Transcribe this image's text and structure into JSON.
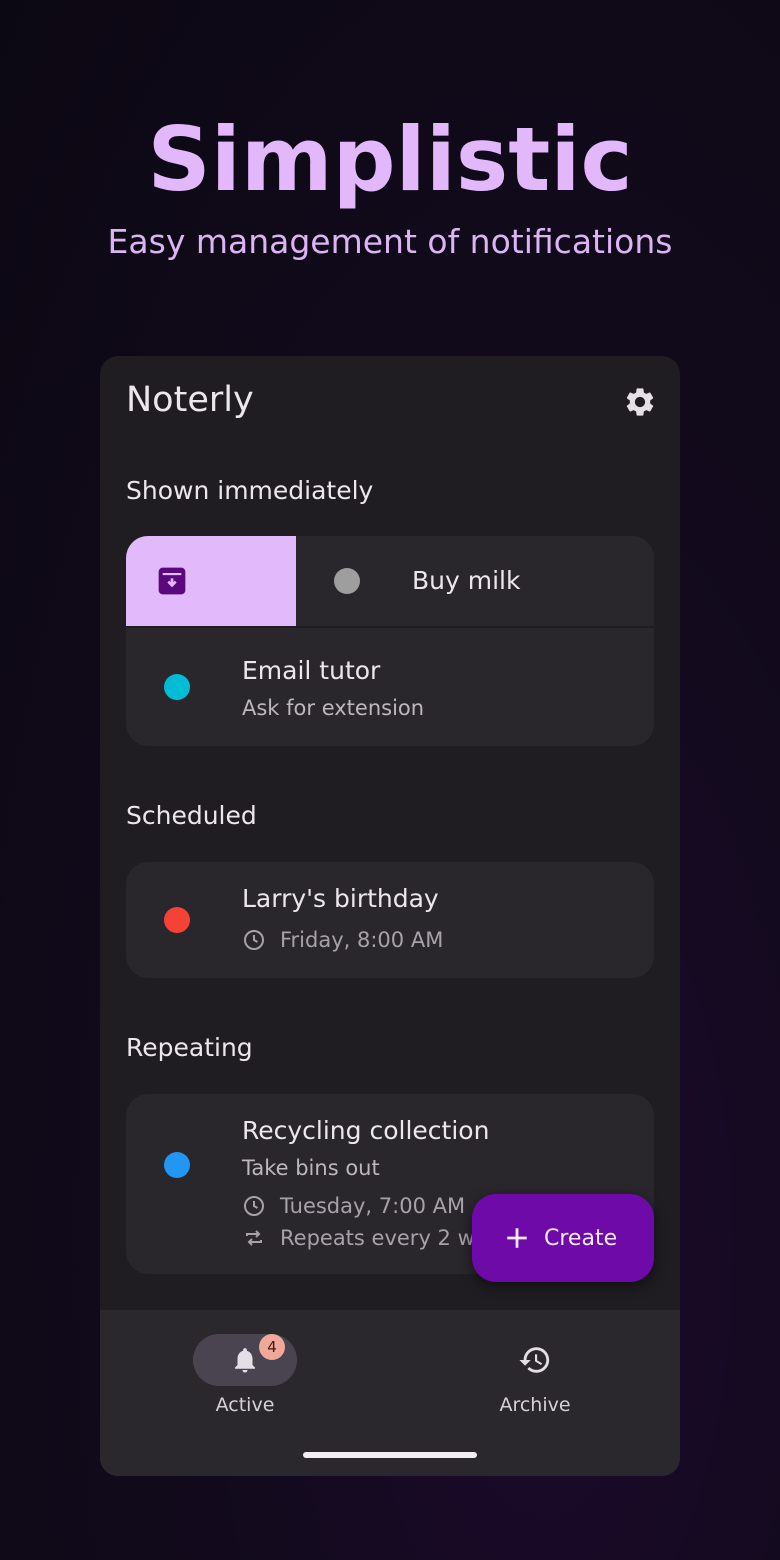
{
  "hero": {
    "title": "Simplistic",
    "subtitle": "Easy management of notifications"
  },
  "app": {
    "title": "Noterly",
    "settings_icon": "gear-icon"
  },
  "sections": {
    "immediate": {
      "label": "Shown immediately",
      "items": [
        {
          "title": "Buy milk",
          "dot_color": "#9e9e9e",
          "swipe_action_icon": "archive-icon",
          "swipe_color": "#e2b9fb"
        },
        {
          "title": "Email tutor",
          "subtitle": "Ask for extension",
          "dot_color": "#00bcd4"
        }
      ]
    },
    "scheduled": {
      "label": "Scheduled",
      "items": [
        {
          "title": "Larry's birthday",
          "time": "Friday, 8:00 AM",
          "dot_color": "#f44336",
          "time_icon": "clock-icon"
        }
      ]
    },
    "repeating": {
      "label": "Repeating",
      "items": [
        {
          "title": "Recycling collection",
          "subtitle": "Take bins out",
          "time": "Tuesday, 7:00 AM",
          "repeat": "Repeats every 2 w",
          "dot_color": "#2196f3",
          "time_icon": "clock-icon",
          "repeat_icon": "repeat-icon"
        }
      ]
    }
  },
  "fab": {
    "label": "Create",
    "icon": "plus-icon",
    "color": "#6e0aa8"
  },
  "nav": {
    "active": {
      "label": "Active",
      "badge": "4",
      "icon": "bell-icon"
    },
    "archive": {
      "label": "Archive",
      "icon": "history-icon"
    }
  }
}
